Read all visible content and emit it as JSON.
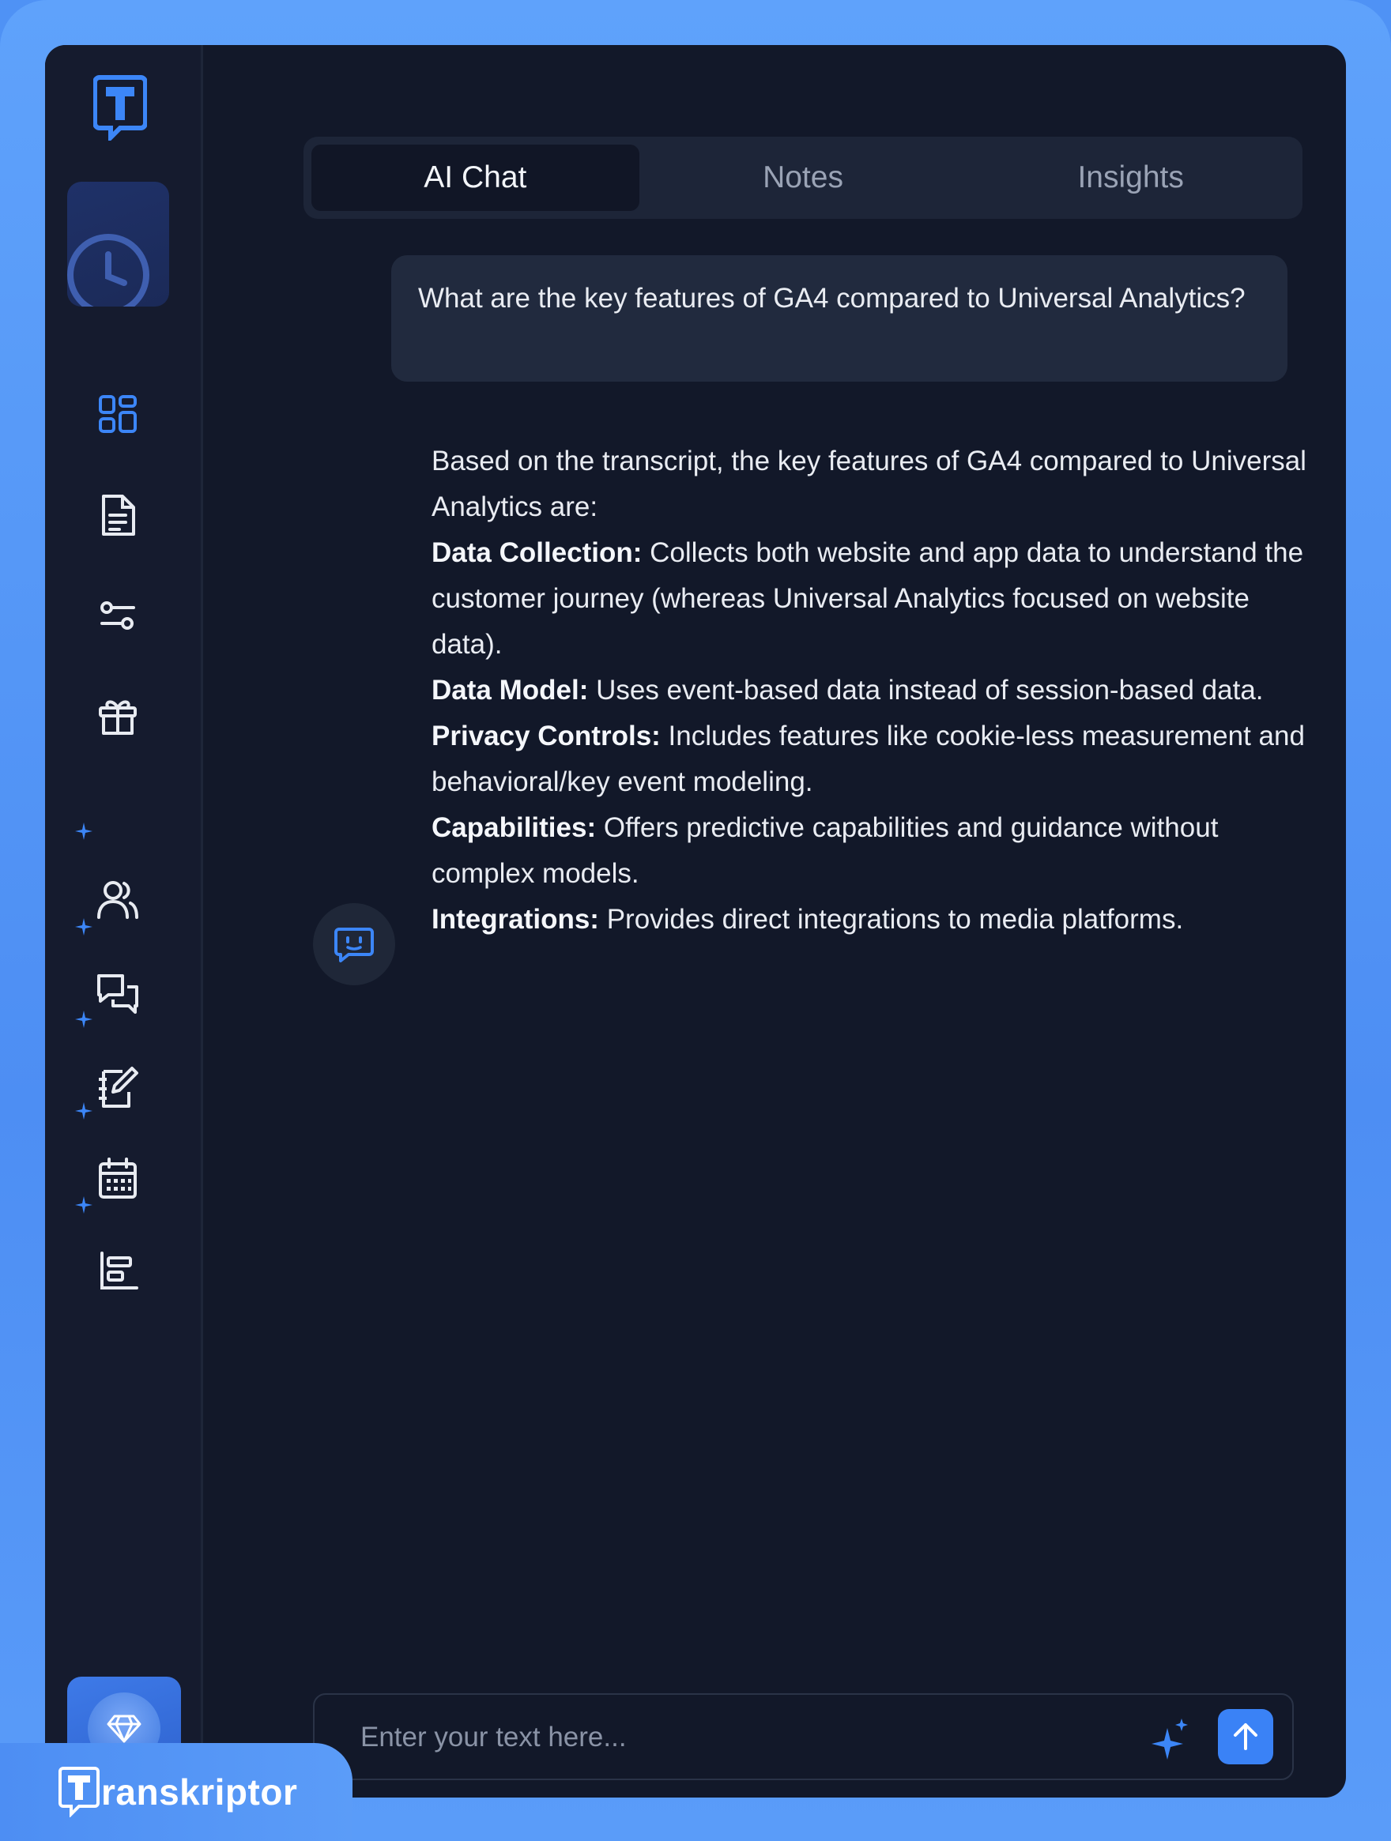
{
  "tabs": [
    {
      "label": "AI Chat",
      "active": true
    },
    {
      "label": "Notes",
      "active": false
    },
    {
      "label": "Insights",
      "active": false
    }
  ],
  "user_message": "What are the key features of GA4 compared to Universal Analytics?",
  "assistant_message": {
    "intro": "Based on the transcript, the key features of GA4 compared to Universal Analytics are:",
    "items": [
      {
        "label": "Data Collection:",
        "text": "Collects both website and app data to understand the customer journey (whereas Universal Analytics focused on website data)."
      },
      {
        "label": "Data Model:",
        "text": "Uses event-based data instead of session-based data."
      },
      {
        "label": "Privacy Controls:",
        "text": "Includes features like cookie-less measurement and behavioral/key event modeling."
      },
      {
        "label": "Capabilities:",
        "text": "Offers predictive capabilities and guidance without complex models."
      },
      {
        "label": "Integrations:",
        "text": "Provides direct integrations to media platforms."
      }
    ]
  },
  "composer": {
    "placeholder": "Enter your text here..."
  },
  "brand": {
    "logo_letter": "T",
    "name_rest": "ranskriptor"
  },
  "sidebar_icons": [
    "dashboard-icon",
    "document-icon",
    "settings-sliders-icon",
    "gift-icon",
    "users-ai-icon",
    "chat-ai-icon",
    "notes-ai-icon",
    "calendar-ai-icon",
    "chart-ai-icon"
  ],
  "colors": {
    "accent": "#3a82f6",
    "background": "#121829",
    "frame": "#5a9cf9"
  }
}
